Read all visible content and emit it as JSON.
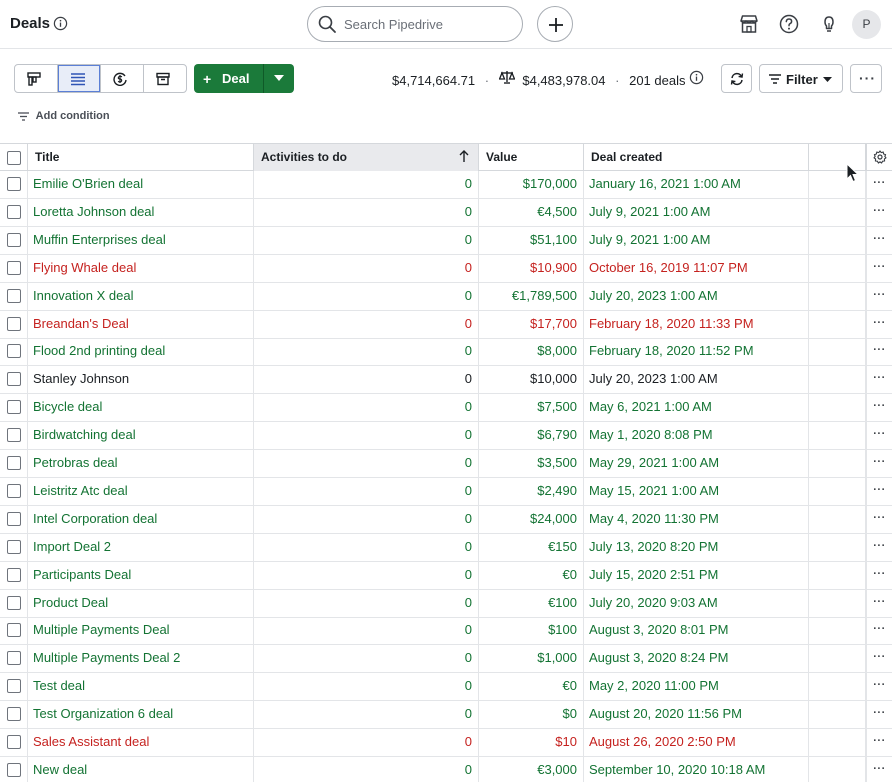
{
  "header": {
    "title": "Deals",
    "search_placeholder": "Search Pipedrive",
    "avatar_initial": "P"
  },
  "toolbar": {
    "deal_button_label": "Deal",
    "total_value": "$4,714,664.71",
    "weighted_value": "$4,483,978.04",
    "deal_count": "201 deals",
    "filter_label": "Filter",
    "add_condition_label": "Add condition"
  },
  "table": {
    "columns": [
      "Title",
      "Activities to do",
      "Value",
      "Deal created"
    ],
    "sorted_column": "Activities to do",
    "rows": [
      {
        "title": "Emilie O'Brien deal",
        "activities": "0",
        "value": "$170,000",
        "created": "January 16, 2021 1:00 AM",
        "status": "green"
      },
      {
        "title": "Loretta Johnson deal",
        "activities": "0",
        "value": "€4,500",
        "created": "July 9, 2021 1:00 AM",
        "status": "green"
      },
      {
        "title": "Muffin Enterprises deal",
        "activities": "0",
        "value": "$51,100",
        "created": "July 9, 2021 1:00 AM",
        "status": "green"
      },
      {
        "title": "Flying Whale deal",
        "activities": "0",
        "value": "$10,900",
        "created": "October 16, 2019 11:07 PM",
        "status": "red"
      },
      {
        "title": "Innovation X deal",
        "activities": "0",
        "value": "€1,789,500",
        "created": "July 20, 2023 1:00 AM",
        "status": "green"
      },
      {
        "title": "Breandan's Deal",
        "activities": "0",
        "value": "$17,700",
        "created": "February 18, 2020 11:33 PM",
        "status": "red"
      },
      {
        "title": "Flood 2nd printing deal",
        "activities": "0",
        "value": "$8,000",
        "created": "February 18, 2020 11:52 PM",
        "status": "green"
      },
      {
        "title": "Stanley Johnson",
        "activities": "0",
        "value": "$10,000",
        "created": "July 20, 2023 1:00 AM",
        "status": "black"
      },
      {
        "title": "Bicycle deal",
        "activities": "0",
        "value": "$7,500",
        "created": "May 6, 2021 1:00 AM",
        "status": "green"
      },
      {
        "title": "Birdwatching deal",
        "activities": "0",
        "value": "$6,790",
        "created": "May 1, 2020 8:08 PM",
        "status": "green"
      },
      {
        "title": "Petrobras deal",
        "activities": "0",
        "value": "$3,500",
        "created": "May 29, 2021 1:00 AM",
        "status": "green"
      },
      {
        "title": "Leistritz Atc deal",
        "activities": "0",
        "value": "$2,490",
        "created": "May 15, 2021 1:00 AM",
        "status": "green"
      },
      {
        "title": "Intel Corporation deal",
        "activities": "0",
        "value": "$24,000",
        "created": "May 4, 2020 11:30 PM",
        "status": "green"
      },
      {
        "title": "Import Deal 2",
        "activities": "0",
        "value": "€150",
        "created": "July 13, 2020 8:20 PM",
        "status": "green"
      },
      {
        "title": "Participants Deal",
        "activities": "0",
        "value": "€0",
        "created": "July 15, 2020 2:51 PM",
        "status": "green"
      },
      {
        "title": "Product Deal",
        "activities": "0",
        "value": "€100",
        "created": "July 20, 2020 9:03 AM",
        "status": "green"
      },
      {
        "title": "Multiple Payments Deal",
        "activities": "0",
        "value": "$100",
        "created": "August 3, 2020 8:01 PM",
        "status": "green"
      },
      {
        "title": "Multiple Payments Deal 2",
        "activities": "0",
        "value": "$1,000",
        "created": "August 3, 2020 8:24 PM",
        "status": "green"
      },
      {
        "title": "Test deal",
        "activities": "0",
        "value": "€0",
        "created": "May 2, 2020 11:00 PM",
        "status": "green"
      },
      {
        "title": "Test Organization 6 deal",
        "activities": "0",
        "value": "$0",
        "created": "August 20, 2020 11:56 PM",
        "status": "green"
      },
      {
        "title": "Sales Assistant deal",
        "activities": "0",
        "value": "$10",
        "created": "August 26, 2020 2:50 PM",
        "status": "red"
      },
      {
        "title": "New deal",
        "activities": "0",
        "value": "€3,000",
        "created": "September 10, 2020 10:18 AM",
        "status": "green"
      }
    ]
  },
  "colors": {
    "brand_green": "#1b7a3a",
    "won_green": "#137333",
    "lost_red": "#c5221f"
  }
}
